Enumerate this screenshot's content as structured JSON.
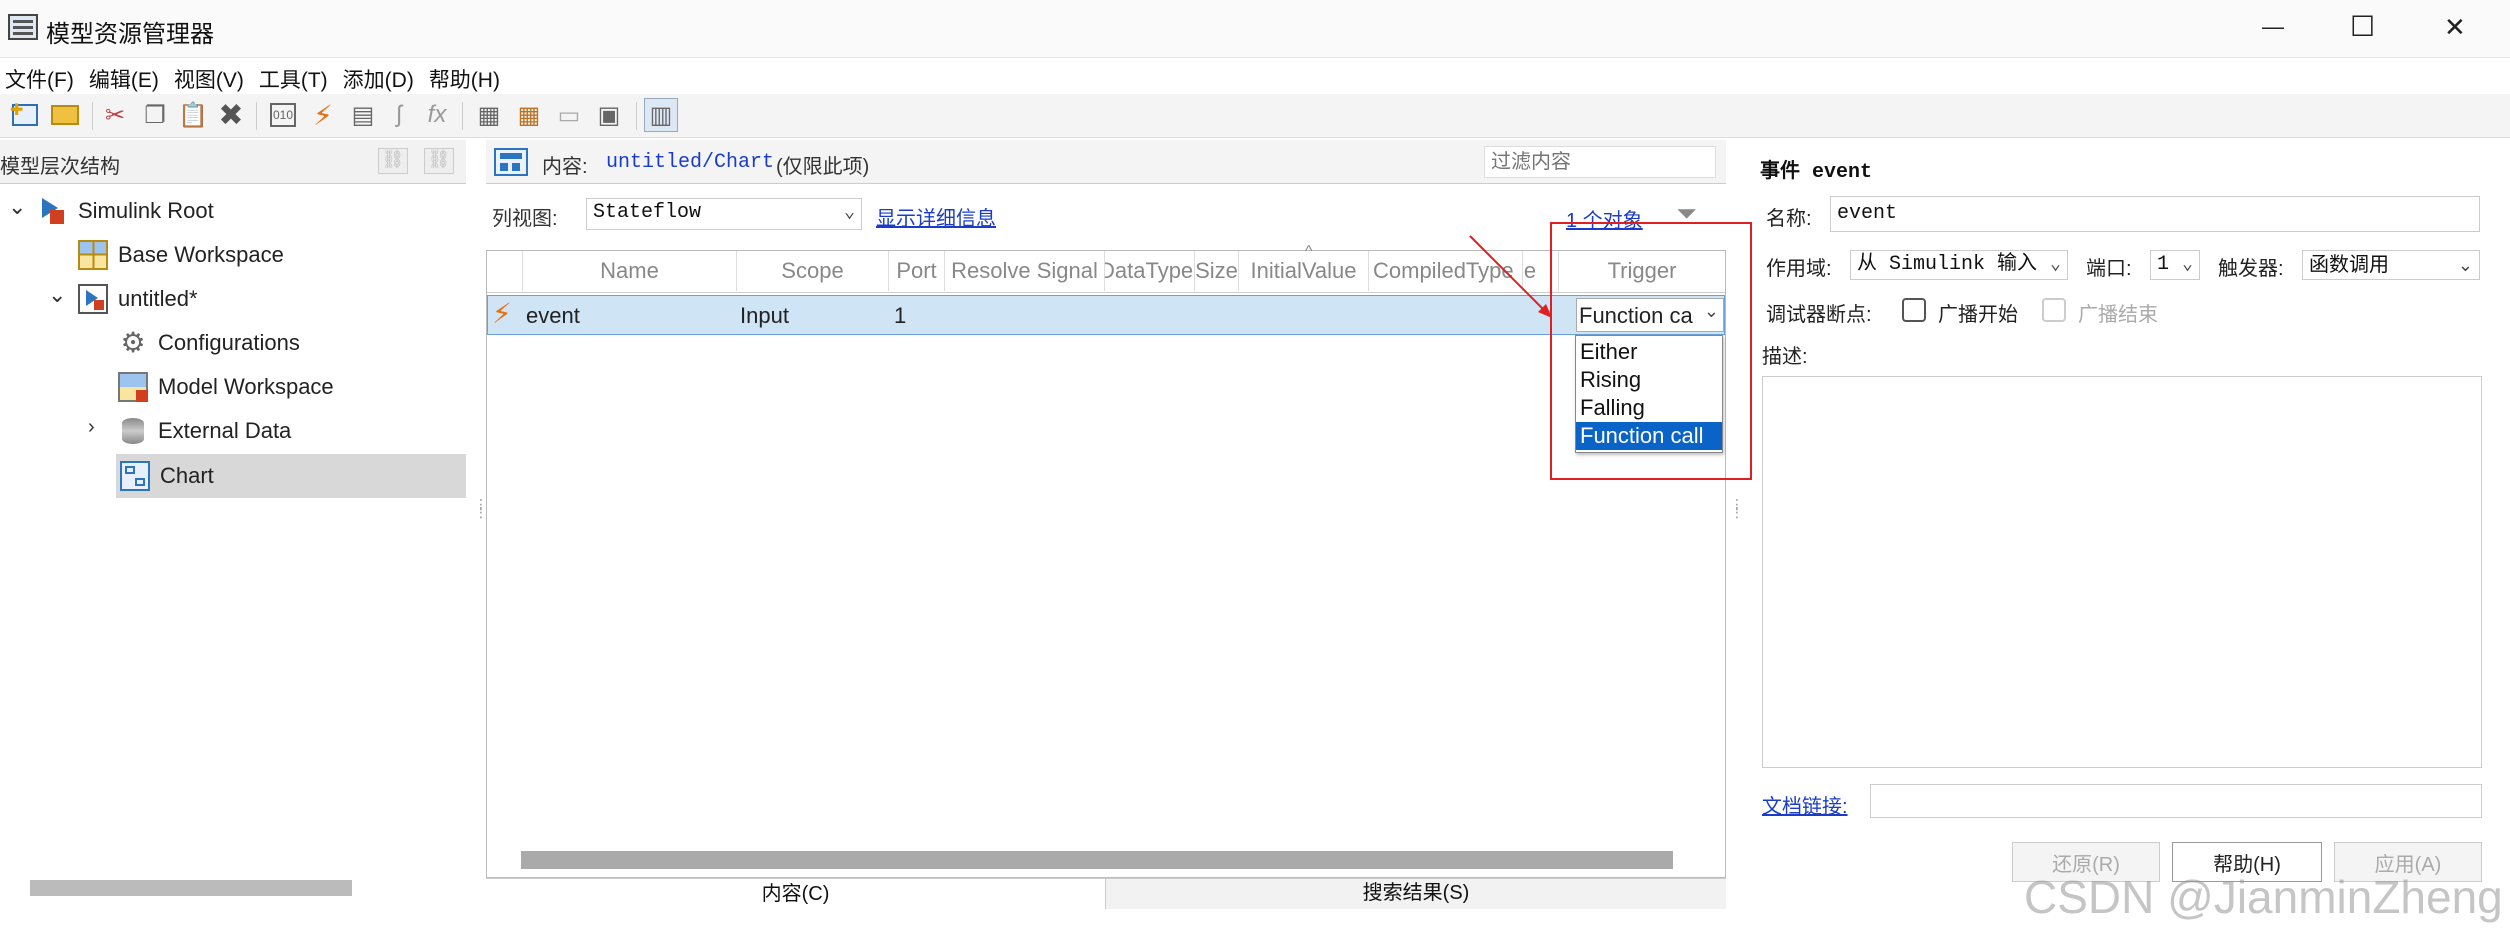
{
  "window": {
    "title": "模型资源管理器",
    "controls": {
      "minimize": "—",
      "maximize": "☐",
      "close": "✕"
    }
  },
  "menu": [
    "文件(F)",
    "编辑(E)",
    "视图(V)",
    "工具(T)",
    "添加(D)",
    "帮助(H)"
  ],
  "toolbar": {
    "icons": [
      "add-model-icon",
      "open-folder-icon",
      "cut-icon",
      "copy-icon",
      "paste-icon",
      "delete-icon",
      "data-icon",
      "event-icon",
      "message-icon",
      "function-icon",
      "fx-icon",
      "properties-icon",
      "table-icon",
      "print-icon",
      "export-icon",
      "columns-icon"
    ]
  },
  "left_pane": {
    "header": "模型层次结构",
    "tree": [
      {
        "label": "Simulink Root",
        "level": 0,
        "expanded": true,
        "icon": "simulink-root-icon"
      },
      {
        "label": "Base Workspace",
        "level": 1,
        "icon": "workspace-grid-icon"
      },
      {
        "label": "untitled*",
        "level": 1,
        "expanded": true,
        "icon": "model-icon"
      },
      {
        "label": "Configurations",
        "level": 2,
        "icon": "gear-icon"
      },
      {
        "label": "Model Workspace",
        "level": 2,
        "icon": "model-workspace-icon"
      },
      {
        "label": "External Data",
        "level": 2,
        "expanded": false,
        "icon": "database-icon"
      },
      {
        "label": "Chart",
        "level": 2,
        "selected": true,
        "icon": "chart-icon"
      }
    ]
  },
  "center_pane": {
    "content_label": "内容:",
    "content_path": "untitled/Chart",
    "content_note": "(仅限此项)",
    "filter_placeholder": "过滤内容",
    "view_label": "列视图:",
    "view_value": "Stateflow",
    "show_details": "显示详细信息",
    "object_count": "1 个对象",
    "columns": [
      "Name",
      "Scope",
      "Port",
      "Resolve Signal",
      "DataType",
      "Size",
      "InitialValue",
      "CompiledType",
      "le",
      "Trigger"
    ],
    "rows": [
      {
        "name": "event",
        "scope": "Input",
        "port": "1",
        "trigger": "Function ca"
      }
    ],
    "trigger_options": [
      "Either",
      "Rising",
      "Falling",
      "Function call"
    ],
    "trigger_selected": "Function call",
    "tabs": [
      "内容(C)",
      "搜索结果(S)"
    ]
  },
  "right_pane": {
    "title": "事件 event",
    "name_label": "名称:",
    "name_value": "event",
    "scope_label": "作用域:",
    "scope_value": "从 Simulink 输入",
    "port_label": "端口:",
    "port_value": "1",
    "trigger_label": "触发器:",
    "trigger_value": "函数调用",
    "debugger_label": "调试器断点:",
    "bp_start": "广播开始",
    "bp_end": "广播结束",
    "desc_label": "描述:",
    "doc_link_label": "文档链接:",
    "buttons": {
      "revert": "还原(R)",
      "help": "帮助(H)",
      "apply": "应用(A)"
    }
  },
  "watermark": "CSDN @JianminZheng",
  "colors": {
    "selection": "#cfe4f5",
    "dropdown_highlight": "#0a64c8",
    "annotation": "#e02020",
    "link": "#1a3cc8"
  }
}
